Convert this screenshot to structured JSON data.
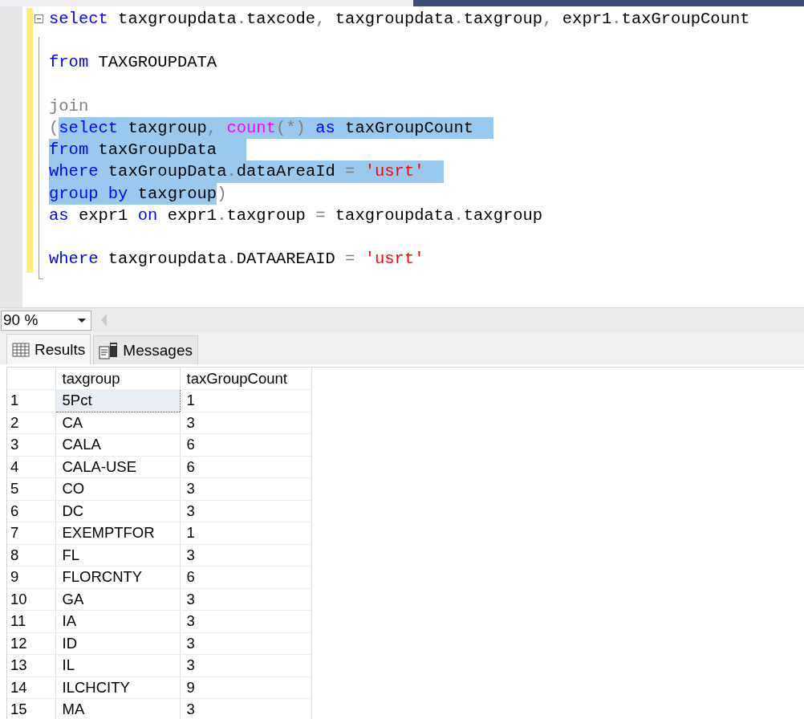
{
  "editor": {
    "lines": [
      {
        "collapsible": true,
        "tokens": [
          {
            "text": "select",
            "kind": "keyword",
            "selected": false
          },
          {
            "text": " taxgroupdata",
            "kind": "ident",
            "selected": false
          },
          {
            "text": ".",
            "kind": "punct",
            "selected": false
          },
          {
            "text": "taxcode",
            "kind": "ident",
            "selected": false
          },
          {
            "text": ",",
            "kind": "punct",
            "selected": false
          },
          {
            "text": " taxgroupdata",
            "kind": "ident",
            "selected": false
          },
          {
            "text": ".",
            "kind": "punct",
            "selected": false
          },
          {
            "text": "taxgroup",
            "kind": "ident",
            "selected": false
          },
          {
            "text": ",",
            "kind": "punct",
            "selected": false
          },
          {
            "text": " expr1",
            "kind": "ident",
            "selected": false
          },
          {
            "text": ".",
            "kind": "punct",
            "selected": false
          },
          {
            "text": "taxGroupCount",
            "kind": "ident",
            "selected": false
          }
        ]
      },
      {
        "collapsible": false
      },
      {
        "collapsible": false,
        "tokens": [
          {
            "text": "from",
            "kind": "keyword",
            "selected": false
          },
          {
            "text": " TAXGROUPDATA",
            "kind": "ident",
            "selected": false
          }
        ]
      },
      {
        "collapsible": false
      },
      {
        "collapsible": false,
        "tokens": [
          {
            "text": "join",
            "kind": "punct",
            "selected": false
          }
        ]
      },
      {
        "collapsible": false,
        "tokens": [
          {
            "text": "(",
            "kind": "punct",
            "selected": false
          },
          {
            "text": "select",
            "kind": "keyword",
            "selected": true
          },
          {
            "text": " taxgroup",
            "kind": "ident",
            "selected": true
          },
          {
            "text": ",",
            "kind": "punct",
            "selected": true
          },
          {
            "text": " count",
            "kind": "function",
            "selected": true
          },
          {
            "text": "(*)",
            "kind": "punct",
            "selected": true
          },
          {
            "text": " as",
            "kind": "keyword",
            "selected": true
          },
          {
            "text": " taxGroupCount  ",
            "kind": "ident",
            "selected": true
          }
        ]
      },
      {
        "collapsible": false,
        "tokens": [
          {
            "text": "from",
            "kind": "keyword",
            "selected": true
          },
          {
            "text": " taxGroupData   ",
            "kind": "ident",
            "selected": true
          }
        ]
      },
      {
        "collapsible": false,
        "tokens": [
          {
            "text": "where",
            "kind": "keyword",
            "selected": true
          },
          {
            "text": " taxGroupData",
            "kind": "ident",
            "selected": true
          },
          {
            "text": ".",
            "kind": "punct",
            "selected": true
          },
          {
            "text": "dataAreaId ",
            "kind": "ident",
            "selected": true
          },
          {
            "text": "=",
            "kind": "punct",
            "selected": true
          },
          {
            "text": " 'usrt'  ",
            "kind": "string",
            "selected": true
          }
        ]
      },
      {
        "collapsible": false,
        "tokens": [
          {
            "text": "group",
            "kind": "keyword",
            "selected": true
          },
          {
            "text": " by",
            "kind": "keyword",
            "selected": true
          },
          {
            "text": " taxgroup",
            "kind": "ident",
            "selected": true
          },
          {
            "text": ")",
            "kind": "punct",
            "selected": false
          }
        ]
      },
      {
        "collapsible": false,
        "tokens": [
          {
            "text": "as",
            "kind": "keyword",
            "selected": false
          },
          {
            "text": " expr1",
            "kind": "ident",
            "selected": false
          },
          {
            "text": " on",
            "kind": "keyword",
            "selected": false
          },
          {
            "text": " expr1",
            "kind": "ident",
            "selected": false
          },
          {
            "text": ".",
            "kind": "punct",
            "selected": false
          },
          {
            "text": "taxgroup ",
            "kind": "ident",
            "selected": false
          },
          {
            "text": "=",
            "kind": "punct",
            "selected": false
          },
          {
            "text": " taxgroupdata",
            "kind": "ident",
            "selected": false
          },
          {
            "text": ".",
            "kind": "punct",
            "selected": false
          },
          {
            "text": "taxgroup",
            "kind": "ident",
            "selected": false
          }
        ]
      },
      {
        "collapsible": false
      },
      {
        "collapsible": false,
        "tokens": [
          {
            "text": "where",
            "kind": "keyword",
            "selected": false
          },
          {
            "text": " taxgroupdata",
            "kind": "ident",
            "selected": false
          },
          {
            "text": ".",
            "kind": "punct",
            "selected": false
          },
          {
            "text": "DATAAREAID ",
            "kind": "ident",
            "selected": false
          },
          {
            "text": "=",
            "kind": "punct",
            "selected": false
          },
          {
            "text": " 'usrt'",
            "kind": "string",
            "selected": false
          }
        ]
      }
    ]
  },
  "zoom": {
    "value": "90 %"
  },
  "tabs": [
    {
      "label": "Results",
      "selected": true
    },
    {
      "label": "Messages",
      "selected": false
    }
  ],
  "table": {
    "columns": [
      "taxgroup",
      "taxGroupCount"
    ],
    "rows": [
      {
        "number": "1",
        "cells": [
          "5Pct",
          "1"
        ],
        "focused": true
      },
      {
        "number": "2",
        "cells": [
          "CA",
          "3"
        ],
        "focused": false
      },
      {
        "number": "3",
        "cells": [
          "CALA",
          "6"
        ],
        "focused": false
      },
      {
        "number": "4",
        "cells": [
          "CALA-USE",
          "6"
        ],
        "focused": false
      },
      {
        "number": "5",
        "cells": [
          "CO",
          "3"
        ],
        "focused": false
      },
      {
        "number": "6",
        "cells": [
          "DC",
          "3"
        ],
        "focused": false
      },
      {
        "number": "7",
        "cells": [
          "EXEMPTFOR",
          "1"
        ],
        "focused": false
      },
      {
        "number": "8",
        "cells": [
          "FL",
          "3"
        ],
        "focused": false
      },
      {
        "number": "9",
        "cells": [
          "FLORCNTY",
          "6"
        ],
        "focused": false
      },
      {
        "number": "10",
        "cells": [
          "GA",
          "3"
        ],
        "focused": false
      },
      {
        "number": "11",
        "cells": [
          "IA",
          "3"
        ],
        "focused": false
      },
      {
        "number": "12",
        "cells": [
          "ID",
          "3"
        ],
        "focused": false
      },
      {
        "number": "13",
        "cells": [
          "IL",
          "3"
        ],
        "focused": false
      },
      {
        "number": "14",
        "cells": [
          "ILCHCITY",
          "9"
        ],
        "focused": false
      },
      {
        "number": "15",
        "cells": [
          "MA",
          "3"
        ],
        "focused": false
      }
    ]
  }
}
